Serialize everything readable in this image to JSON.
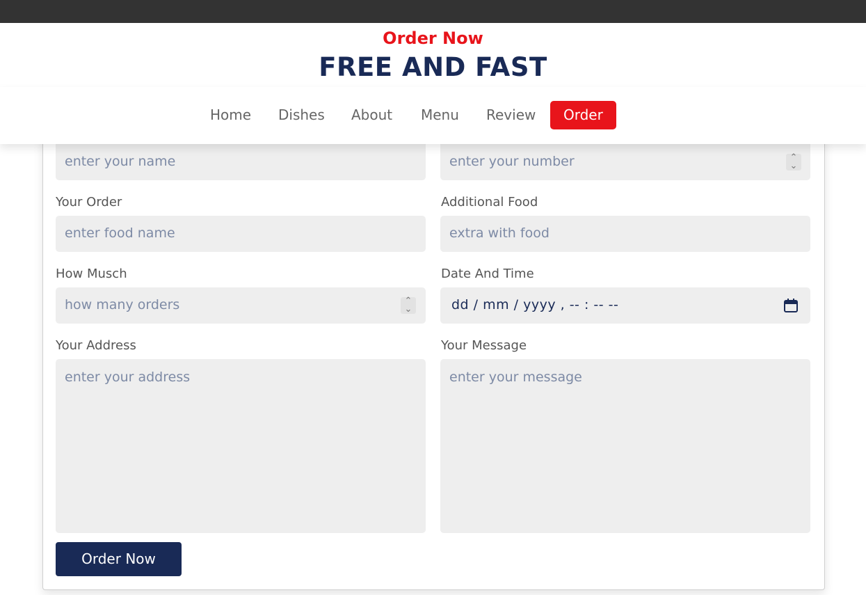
{
  "header": {
    "subtitle": "Order Now",
    "title": "FREE AND FAST"
  },
  "nav": {
    "items": [
      "Home",
      "Dishes",
      "About",
      "Menu",
      "Review",
      "Order"
    ],
    "active": "Order"
  },
  "form": {
    "name_placeholder": "enter your name",
    "number_placeholder": "enter your number",
    "order_label": "Your Order",
    "order_placeholder": "enter food name",
    "additional_label": "Additional Food",
    "additional_placeholder": "extra with food",
    "howmuch_label": "How Musch",
    "howmuch_placeholder": "how many orders",
    "datetime_label": "Date And Time",
    "datetime_value": "dd / mm / yyyy ,  -- : --   --",
    "address_label": "Your Address",
    "address_placeholder": "enter your address",
    "message_label": "Your Message",
    "message_placeholder": "enter your message",
    "submit_label": "Order Now"
  },
  "colors": {
    "accent": "#e8141b",
    "brand": "#192a56",
    "field_bg": "#eeeeee",
    "topbar": "#333333"
  },
  "icons": {
    "spinner": "spinner-arrows-icon",
    "calendar": "calendar-icon"
  }
}
